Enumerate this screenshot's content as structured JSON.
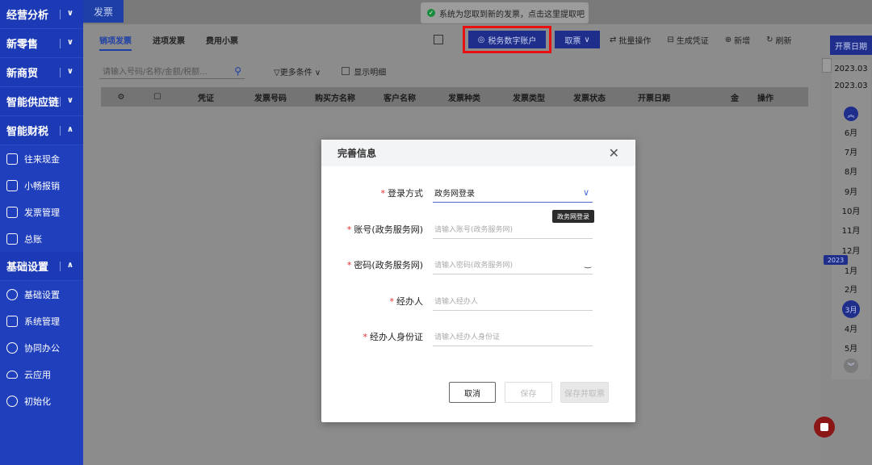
{
  "sidebar": {
    "groups": [
      {
        "label": "经营分析"
      },
      {
        "label": "新零售"
      },
      {
        "label": "新商贸"
      },
      {
        "label": "智能供应链"
      },
      {
        "label": "智能财税"
      }
    ],
    "fin_items": [
      {
        "label": "往来现金",
        "icon": "transfer-icon"
      },
      {
        "label": "小畅报销",
        "icon": "grid-icon"
      },
      {
        "label": "发票管理",
        "icon": "invoice-icon"
      },
      {
        "label": "总账",
        "icon": "ledger-icon"
      }
    ],
    "base_group": {
      "label": "基础设置"
    },
    "base_items": [
      {
        "label": "基础设置",
        "icon": "settings-icon"
      },
      {
        "label": "系统管理",
        "icon": "system-icon"
      },
      {
        "label": "协同办公",
        "icon": "collab-icon"
      },
      {
        "label": "云应用",
        "icon": "cloud-icon"
      },
      {
        "label": "初始化",
        "icon": "init-icon"
      }
    ]
  },
  "page_tab": "发票",
  "toast": "系统为您取到新的发票，点击这里提取吧",
  "subtabs": [
    "销项发票",
    "进项发票",
    "费用小票"
  ],
  "toolbar": {
    "account_btn": "税务数字账户",
    "ticket_btn": "取票",
    "batch": "批量操作",
    "voucher": "生成凭证",
    "add": "新增",
    "refresh": "刷新"
  },
  "search": {
    "placeholder": "请输入号码/名称/金额/税额...",
    "more": "更多条件",
    "show_detail": "显示明细"
  },
  "table_headers": [
    "凭证",
    "发票号码",
    "购买方名称",
    "客户名称",
    "发票种类",
    "发票类型",
    "发票状态",
    "开票日期",
    "金",
    "操作"
  ],
  "date_panel": {
    "header": "开票日期",
    "top_dates": [
      "2023.03",
      "2023.03"
    ],
    "months": [
      "6月",
      "7月",
      "8月",
      "9月",
      "10月",
      "11月",
      "12月",
      "1月",
      "2月",
      "3月",
      "4月",
      "5月"
    ],
    "year_badge": "2023",
    "selected_month": "3月"
  },
  "modal": {
    "title": "完善信息",
    "fields": [
      {
        "label": "登录方式",
        "value": "政务网登录",
        "placeholder": ""
      },
      {
        "label": "账号(政务服务网)",
        "value": "",
        "placeholder": "请输入账号(政务服务网)"
      },
      {
        "label": "密码(政务服务网)",
        "value": "",
        "placeholder": "请输入密码(政务服务网)"
      },
      {
        "label": "经办人",
        "value": "",
        "placeholder": "请输入经办人"
      },
      {
        "label": "经办人身份证",
        "value": "",
        "placeholder": "请输入经办人身份证"
      }
    ],
    "tooltip": "政务网登录",
    "cancel": "取消",
    "save": "保存",
    "save_get": "保存并取票"
  }
}
